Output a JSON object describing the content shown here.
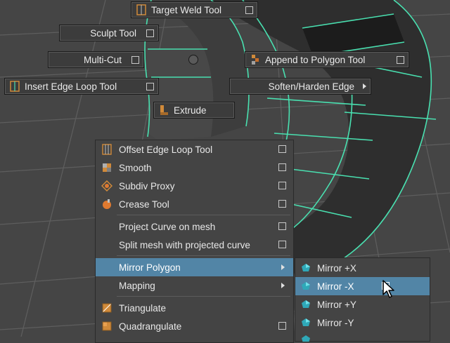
{
  "marking_menu": {
    "target_weld": "Target Weld Tool",
    "sculpt": "Sculpt Tool",
    "multi_cut": "Multi-Cut",
    "append_polygon": "Append to Polygon Tool",
    "insert_edge_loop": "Insert Edge Loop Tool",
    "soften_harden": "Soften/Harden Edge",
    "extrude": "Extrude"
  },
  "menu": {
    "items": [
      {
        "label": "Offset Edge Loop Tool"
      },
      {
        "label": "Smooth"
      },
      {
        "label": "Subdiv Proxy"
      },
      {
        "label": "Crease Tool"
      },
      {
        "label": "Project Curve on mesh"
      },
      {
        "label": "Split mesh with projected curve"
      },
      {
        "label": "Mirror Polygon"
      },
      {
        "label": "Mapping"
      },
      {
        "label": "Triangulate"
      },
      {
        "label": "Quadrangulate"
      }
    ]
  },
  "submenu": {
    "items": [
      {
        "label": "Mirror +X"
      },
      {
        "label": "Mirror -X"
      },
      {
        "label": "Mirror +Y"
      },
      {
        "label": "Mirror -Y"
      }
    ]
  },
  "colors": {
    "background": "#454545",
    "menu_bg": "#444444",
    "highlight": "#5285a6",
    "wireframe": "#49e0b0",
    "mesh_dark": "#2a2a2a",
    "mesh_mid": "#3a3a3a"
  },
  "icons": {
    "offset_edge_loop": "offset-edge-loop-icon",
    "smooth": "smooth-icon",
    "subdiv_proxy": "subdiv-proxy-icon",
    "crease": "crease-tool-icon",
    "triangulate": "triangulate-icon",
    "quadrangulate": "quadrangulate-icon",
    "mirror": "mirror-icon",
    "cursor": "arrow-cursor-icon"
  }
}
